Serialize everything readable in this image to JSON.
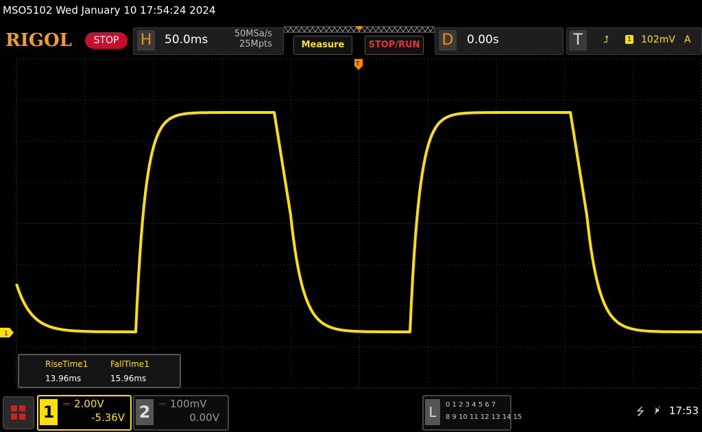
{
  "titlebar": {
    "text": "MSO5102  Wed January 10 17:54:24 2024"
  },
  "toolbar": {
    "logo": "RIGOL",
    "run_state": "STOP",
    "horizontal": {
      "letter": "H",
      "timebase": "50.0ms",
      "sample_rate": "50MSa/s",
      "memory_depth": "25Mpts"
    },
    "measure_label": "Measure",
    "stoprun_label": "STOP/RUN",
    "delay": {
      "letter": "D",
      "value": "0.00s"
    },
    "trigger": {
      "letter": "T",
      "edge_icon": "rising-edge-icon",
      "edge_glyph": "⮥",
      "channel": "1",
      "level": "102mV",
      "coupling": "A"
    }
  },
  "screen": {
    "ch1_marker": "1",
    "trigger_marker": "T",
    "trace_color": "#ffe000"
  },
  "measurements": {
    "items": [
      {
        "label": "RiseTime1",
        "value": "13.96ms"
      },
      {
        "label": "FallTime1",
        "value": "15.96ms"
      }
    ]
  },
  "bottombar": {
    "ch1": {
      "number": "1",
      "coupling": "⎓",
      "scale": "2.00V",
      "offset": "-5.36V",
      "color": "#ffe000"
    },
    "ch2": {
      "number": "2",
      "coupling": "⎓",
      "scale": "100mV",
      "offset": "0.00V"
    },
    "logic": {
      "letter": "L",
      "row1": "0 1 2 3   4 5 6 7",
      "row2": "8  9 10 11  12 13 14 15"
    },
    "usb_icon": "⭍",
    "speaker_icon": "🕨̸",
    "clock": "17:53"
  },
  "colors": {
    "accent_orange": "#ff8a00",
    "logo": "#f0a020",
    "stop_red": "#c8102e",
    "channel1": "#ffe000"
  }
}
